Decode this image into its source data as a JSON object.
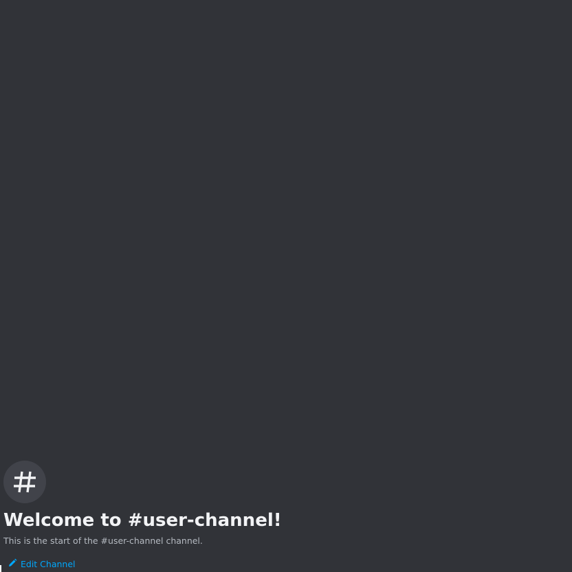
{
  "colors": {
    "background": "#313338",
    "icon_circle": "#41434a",
    "title": "#f2f3f5",
    "subtitle": "#b5bac1",
    "link": "#00a8fc"
  },
  "channel_welcome": {
    "icon": "hash-icon",
    "title": "Welcome to #user-channel!",
    "subtitle": "This is the start of the #user-channel channel.",
    "edit_link": {
      "icon": "pencil-icon",
      "label": "Edit Channel"
    }
  }
}
